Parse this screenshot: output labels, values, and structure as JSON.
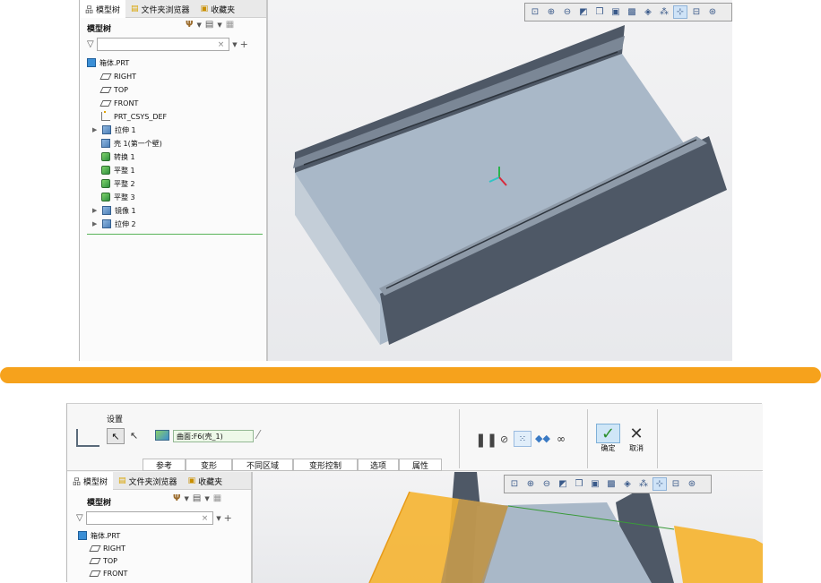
{
  "top": {
    "nav_tabs": [
      {
        "label": "模型树",
        "icon": "model-tree-icon"
      },
      {
        "label": "文件夹浏览器",
        "icon": "folder-browser-icon"
      },
      {
        "label": "收藏夹",
        "icon": "favorites-icon"
      }
    ],
    "tree_title": "模型树",
    "filter_placeholder": "",
    "tree": [
      {
        "label": "箱体.PRT",
        "icon": "part-icon",
        "expand": false,
        "indent": 0
      },
      {
        "label": "RIGHT",
        "icon": "datum-plane-icon",
        "expand": false,
        "indent": 1
      },
      {
        "label": "TOP",
        "icon": "datum-plane-icon",
        "expand": false,
        "indent": 1
      },
      {
        "label": "FRONT",
        "icon": "datum-plane-icon",
        "expand": false,
        "indent": 1
      },
      {
        "label": "PRT_CSYS_DEF",
        "icon": "csys-icon",
        "expand": false,
        "indent": 1
      },
      {
        "label": "拉伸 1",
        "icon": "extrude-icon",
        "expand": true,
        "indent": 1
      },
      {
        "label": "壳 1(第一个壁)",
        "icon": "shell-icon",
        "expand": false,
        "indent": 1
      },
      {
        "label": "转换 1",
        "icon": "conversion-icon",
        "expand": false,
        "indent": 1
      },
      {
        "label": "平整 1",
        "icon": "flat-wall-icon",
        "expand": false,
        "indent": 1
      },
      {
        "label": "平整 2",
        "icon": "flat-wall-icon",
        "expand": false,
        "indent": 1
      },
      {
        "label": "平整 3",
        "icon": "flat-wall-icon",
        "expand": false,
        "indent": 1
      },
      {
        "label": "镜像 1",
        "icon": "mirror-icon",
        "expand": true,
        "indent": 1
      },
      {
        "label": "拉伸 2",
        "icon": "extrude-icon",
        "expand": true,
        "indent": 1
      }
    ]
  },
  "bottom": {
    "settings_label": "设置",
    "reference_value": "曲面:F6(壳_1)",
    "tabs": [
      "参考",
      "变形",
      "不同区域",
      "变形控制",
      "选项",
      "属性"
    ],
    "confirm_label": "确定",
    "cancel_label": "取消",
    "nav_tabs": [
      {
        "label": "模型树",
        "icon": "model-tree-icon"
      },
      {
        "label": "文件夹浏览器",
        "icon": "folder-browser-icon"
      },
      {
        "label": "收藏夹",
        "icon": "favorites-icon"
      }
    ],
    "tree_title": "模型树",
    "tree": [
      {
        "label": "箱体.PRT",
        "icon": "part-icon"
      },
      {
        "label": "RIGHT",
        "icon": "datum-plane-icon"
      },
      {
        "label": "TOP",
        "icon": "datum-plane-icon"
      },
      {
        "label": "FRONT",
        "icon": "datum-plane-icon"
      }
    ]
  },
  "colors": {
    "accent_orange": "#f6a21c",
    "model_top": "#a8b8c8",
    "model_side": "#4e5866",
    "selection_yellow": "#f5b431",
    "confirm_green": "#2a8f2a"
  }
}
